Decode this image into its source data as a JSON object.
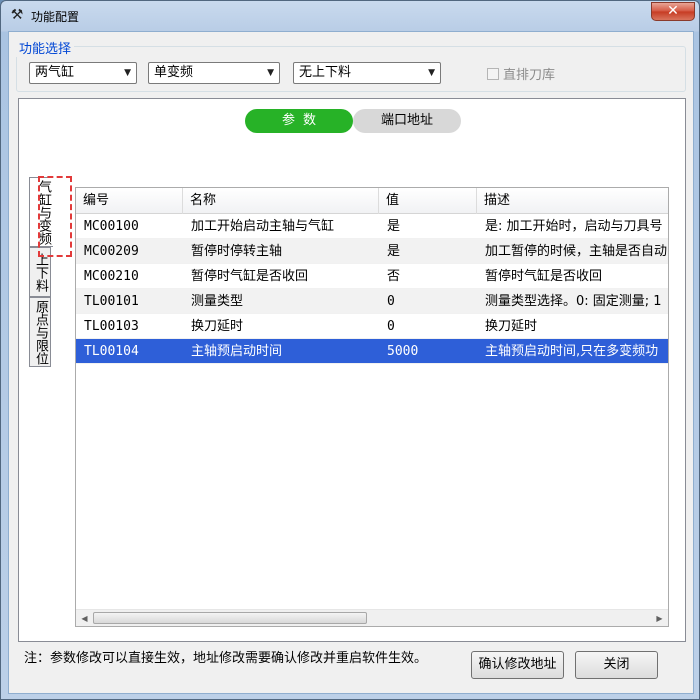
{
  "window": {
    "title": "功能配置",
    "close_label": "✕"
  },
  "function_select": {
    "title": "功能选择",
    "cylinder_combo": "两气缸",
    "inverter_combo": "单变频",
    "loading_combo": "无上下料",
    "inline_magazine_label": "直排刀库",
    "inline_magazine_checked": false
  },
  "segment": {
    "params_label": "参数",
    "port_label": "端口地址"
  },
  "vertical_tabs": [
    {
      "label": "气缸与变频"
    },
    {
      "label": "上下料"
    },
    {
      "label": "原点与限位"
    }
  ],
  "table": {
    "columns": [
      "编号",
      "名称",
      "值",
      "描述"
    ],
    "rows": [
      {
        "id": "MC00100",
        "name": "加工开始启动主轴与气缸",
        "value": "是",
        "desc": "是: 加工开始时，启动与刀具号"
      },
      {
        "id": "MC00209",
        "name": "暂停时停转主轴",
        "value": "是",
        "desc": "加工暂停的时候，主轴是否自动"
      },
      {
        "id": "MC00210",
        "name": "暂停时气缸是否收回",
        "value": "否",
        "desc": "暂停时气缸是否收回"
      },
      {
        "id": "TL00101",
        "name": "测量类型",
        "value": "0",
        "desc": "测量类型选择。0: 固定测量; 1"
      },
      {
        "id": "TL00103",
        "name": "换刀延时",
        "value": "0",
        "desc": "换刀延时"
      },
      {
        "id": "TL00104",
        "name": "主轴预启动时间",
        "value": "5000",
        "desc": "主轴预启动时间,只在多变频功"
      }
    ],
    "selected_row": 5
  },
  "footer": {
    "note": "注：参数修改可以直接生效，地址修改需要确认修改并重启软件生效。",
    "confirm_label": "确认修改地址",
    "close_label": "关闭"
  }
}
